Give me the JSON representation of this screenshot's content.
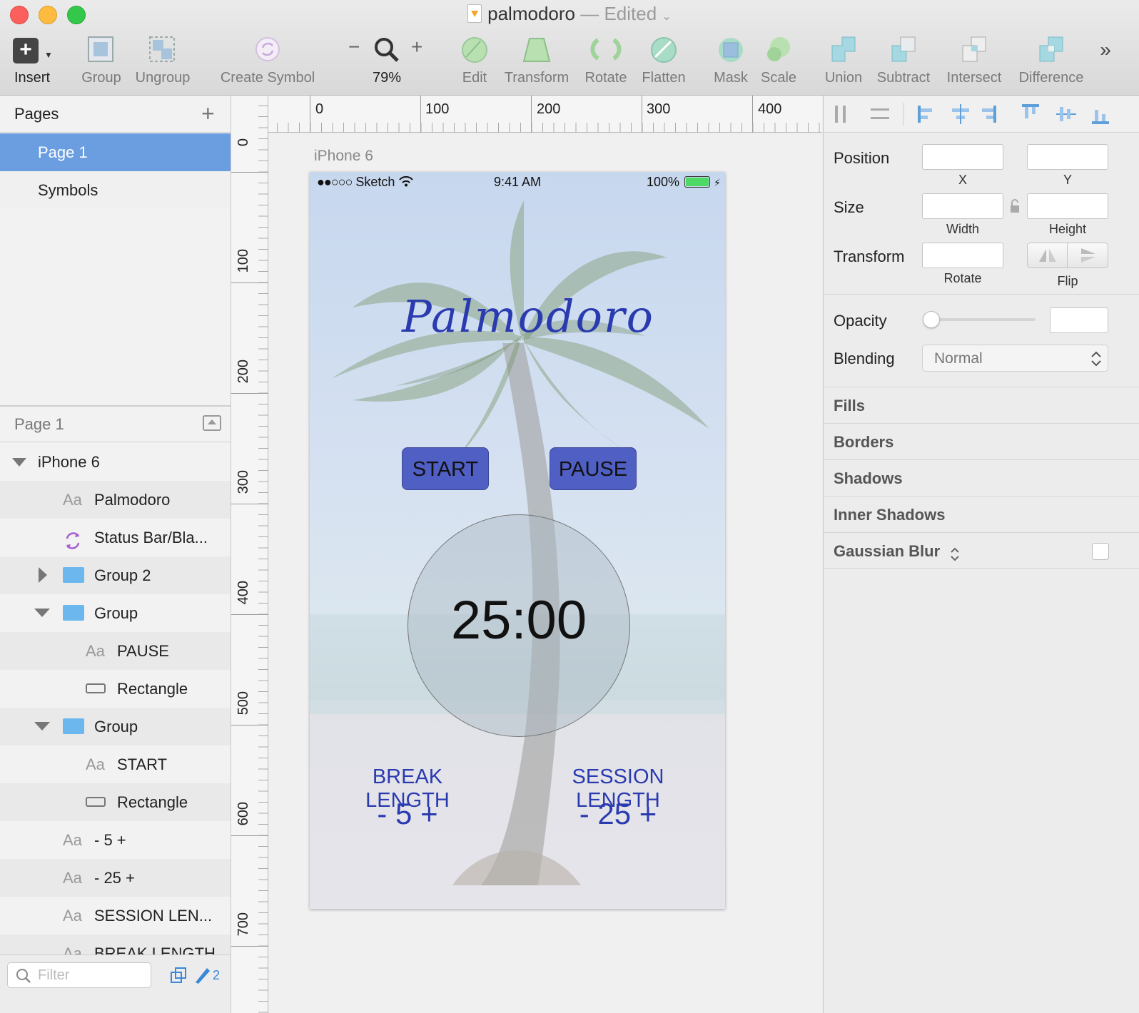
{
  "window": {
    "file_name": "palmodoro",
    "separator": "—",
    "status": "Edited"
  },
  "toolbar": {
    "insert": "Insert",
    "group": "Group",
    "ungroup": "Ungroup",
    "create_symbol": "Create Symbol",
    "zoom_minus": "−",
    "zoom_plus": "+",
    "zoom_level": "79%",
    "edit": "Edit",
    "transform": "Transform",
    "rotate": "Rotate",
    "flatten": "Flatten",
    "mask": "Mask",
    "scale": "Scale",
    "union": "Union",
    "subtract": "Subtract",
    "intersect": "Intersect",
    "difference": "Difference",
    "overflow": "»"
  },
  "pages_panel": {
    "title": "Pages",
    "add": "+",
    "pages": [
      "Page 1",
      "Symbols"
    ]
  },
  "layers_panel": {
    "page_name": "Page 1",
    "layers": [
      {
        "name": "iPhone 6",
        "type": "artboard"
      },
      {
        "name": "Palmodoro",
        "type": "text",
        "prefix": "Aa"
      },
      {
        "name": "Status Bar/Bla...",
        "type": "symbol"
      },
      {
        "name": "Group 2",
        "type": "group-collapsed"
      },
      {
        "name": "Group",
        "type": "group"
      },
      {
        "name": "PAUSE",
        "type": "text",
        "prefix": "Aa"
      },
      {
        "name": "Rectangle",
        "type": "rect"
      },
      {
        "name": "Group",
        "type": "group"
      },
      {
        "name": "START",
        "type": "text",
        "prefix": "Aa"
      },
      {
        "name": "Rectangle",
        "type": "rect"
      },
      {
        "name": "- 5 +",
        "type": "text",
        "prefix": "Aa"
      },
      {
        "name": "- 25 +",
        "type": "text",
        "prefix": "Aa"
      },
      {
        "name": "SESSION LEN...",
        "type": "text",
        "prefix": "Aa"
      },
      {
        "name": "BREAK LENGTH",
        "type": "text",
        "prefix": "Aa"
      }
    ],
    "filter_placeholder": "Filter",
    "selected_count": "2"
  },
  "rulers": {
    "horizontal": [
      "0",
      "100",
      "200",
      "300",
      "400"
    ],
    "vertical": [
      "0",
      "100",
      "200",
      "300",
      "400",
      "500",
      "600",
      "700"
    ]
  },
  "artboard": {
    "label": "iPhone 6",
    "status_bar": {
      "carrier": "Sketch",
      "time": "9:41 AM",
      "battery": "100%"
    },
    "app_title": "Palmodoro",
    "start_label": "START",
    "pause_label": "PAUSE",
    "timer": "25:00",
    "break_label": "BREAK LENGTH",
    "break_value": "- 5 +",
    "session_label": "SESSION LENGTH",
    "session_value": "- 25 +",
    "button_color": "#4f5fc4",
    "text_blue": "#2a3bb0"
  },
  "inspector": {
    "position": "Position",
    "x": "X",
    "y": "Y",
    "size": "Size",
    "width": "Width",
    "height": "Height",
    "transform": "Transform",
    "rotate": "Rotate",
    "flip": "Flip",
    "opacity": "Opacity",
    "blending": "Blending",
    "blending_value": "Normal",
    "sections": [
      "Fills",
      "Borders",
      "Shadows",
      "Inner Shadows",
      "Gaussian Blur"
    ]
  }
}
